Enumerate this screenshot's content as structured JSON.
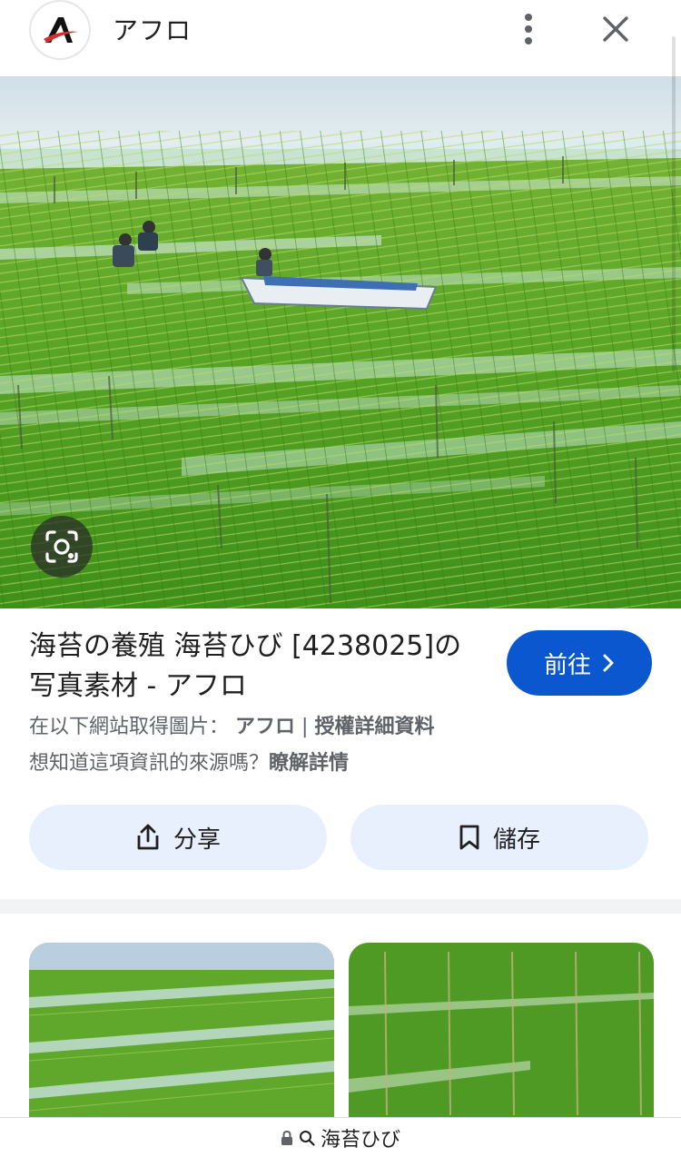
{
  "header": {
    "site_name": "アフロ",
    "logo_letter": "A"
  },
  "hero": {
    "icon": "image-search-lens-icon"
  },
  "result": {
    "title": "海苔の養殖 海苔ひび [4238025]の写真素材 - アフロ",
    "visit_label": "前往",
    "source_prefix": "在以下網站取得圖片：",
    "source_name": "アフロ",
    "source_separator": "|",
    "license_link": "授權詳細資料",
    "about_prefix": "想知道這項資訊的來源嗎？",
    "about_link": "瞭解詳情"
  },
  "actions": {
    "share_label": "分享",
    "save_label": "儲存"
  },
  "urlbar": {
    "query": "海苔ひび"
  },
  "colors": {
    "accent": "#0b57d0",
    "pill_bg": "#e8f0fe",
    "muted_text": "#5f6368",
    "logo_red": "#d32f2f"
  }
}
